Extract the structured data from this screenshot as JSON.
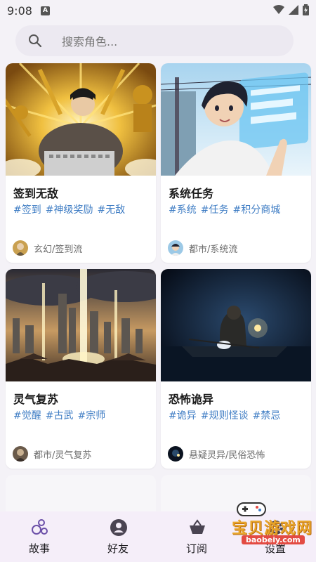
{
  "status": {
    "time": "9:08",
    "a_badge": "A"
  },
  "search": {
    "placeholder": "搜索角色..."
  },
  "cards": [
    {
      "title": "签到无敌",
      "tags": [
        "#签到",
        "#神级奖励",
        "#无敌"
      ],
      "category": "玄幻/签到流"
    },
    {
      "title": "系统任务",
      "tags": [
        "#系统",
        "#任务",
        "#积分商城"
      ],
      "category": "都市/系统流"
    },
    {
      "title": "灵气复苏",
      "tags": [
        "#觉醒",
        "#古武",
        "#宗师"
      ],
      "category": "都市/灵气复苏"
    },
    {
      "title": "恐怖诡异",
      "tags": [
        "#诡异",
        "#规则怪谈",
        "#禁忌"
      ],
      "category": "悬疑灵异/民俗恐怖"
    }
  ],
  "nav": {
    "items": [
      {
        "label": "故事",
        "icon": "bubbles-icon"
      },
      {
        "label": "好友",
        "icon": "person-icon"
      },
      {
        "label": "订阅",
        "icon": "basket-icon"
      },
      {
        "label": "设置",
        "icon": "gear-icon"
      }
    ]
  },
  "watermark": {
    "title": "宝贝游戏网",
    "url": "baobeiy.com"
  },
  "colors": {
    "tag": "#3f7dc4",
    "nav_bg": "#f5eef9",
    "page_bg": "#f4f2f7"
  }
}
